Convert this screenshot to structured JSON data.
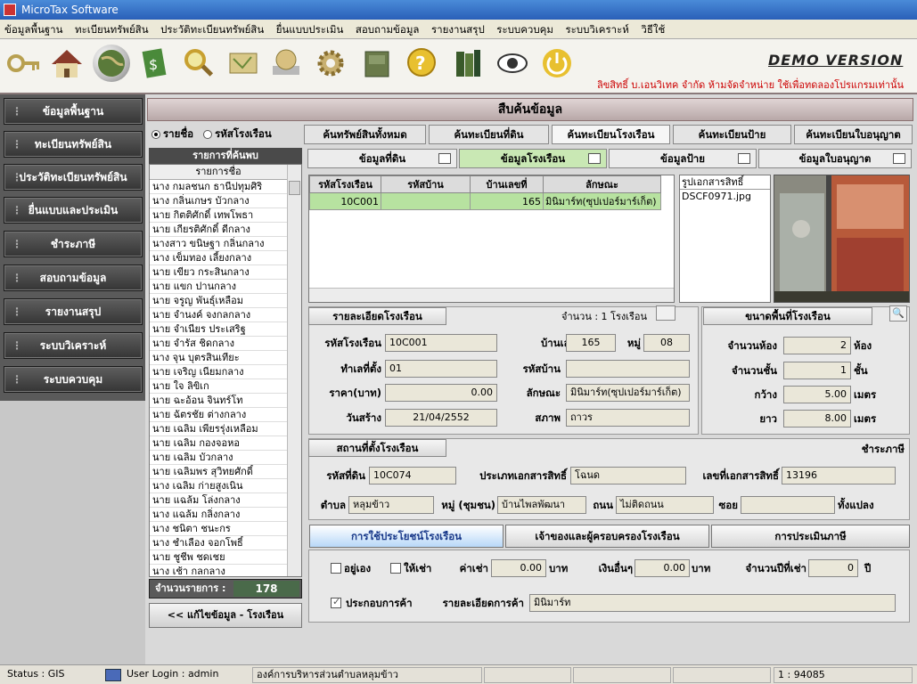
{
  "window": {
    "title": "MicroTax Software"
  },
  "menu": [
    "ข้อมูลพื้นฐาน",
    "ทะเบียนทรัพย์สิน",
    "ประวัติทะเบียนทรัพย์สิน",
    "ยื่นแบบประเมิน",
    "สอบถามข้อมูล",
    "รายงานสรุป",
    "ระบบควบคุม",
    "ระบบวิเคราะห์",
    "วิธีใช้"
  ],
  "toolbar": {
    "icons": [
      "key-icon",
      "house-icon",
      "globe-icon",
      "money-icon",
      "search-icon",
      "map-icon",
      "globe-book-icon",
      "gear-icon",
      "drive-icon",
      "help-icon",
      "books-icon",
      "eye-icon",
      "power-icon"
    ]
  },
  "demo": "DEMO VERSION",
  "copyright": "ลิขสิทธิ์ บ.เอนวิเทค จำกัด ห้ามจัดจำหน่าย ใช้เพื่อทดลองโปรแกรมเท่านั้น",
  "nav": [
    "ข้อมูลพื้นฐาน",
    "ทะเบียนทรัพย์สิน",
    "ประวัติทะเบียนทรัพย์สิน",
    "ยื่นแบบและประเมิน",
    "ชำระภาษี",
    "สอบถามข้อมูล",
    "รายงานสรุป",
    "ระบบวิเคราะห์",
    "ระบบควบคุม"
  ],
  "header": "สืบค้นข้อมูล",
  "search_mode": {
    "by_name": "รายชื่อ",
    "by_code": "รหัสโรงเรือน"
  },
  "tabs": [
    "ค้นทรัพย์สินทั้งหมด",
    "ค้นทะเบียนที่ดิน",
    "ค้นทะเบียนโรงเรือน",
    "ค้นทะเบียนป้าย",
    "ค้นทะเบียนใบอนุญาต"
  ],
  "subtabs": [
    "ข้อมูลที่ดิน",
    "ข้อมูลโรงเรือน",
    "ข้อมูลป้าย",
    "ข้อมูลใบอนุญาต"
  ],
  "list": {
    "title": "รายการที่ค้นพบ",
    "column": "รายการชื่อ",
    "rows": [
      "นาง กมลชนก ธานีปทุมศิริ",
      "นาง กลิ่นเกษร บัวกลาง",
      "นาย กิตติศักดิ์ เทพโพธา",
      "นาย เกียรติศักดิ์ ดีกลาง",
      "นางสาว ขนิษฐา กลิ่นกลาง",
      "นาง เข็มทอง เลี้ยงกลาง",
      "นาย เขียว กระสินกลาง",
      "นาย แขก ปานกลาง",
      "นาย จรูญ พันธุ์เหลือม",
      "นาย จำนงค์ จงกลกลาง",
      "นาย จำเนียร ประเสริฐ",
      "นาย จำรัส ชิดกลาง",
      "นาง จุน บุตรสินเทียะ",
      "นาย เจริญ เนียมกลาง",
      "นาย ใจ ลิขิเก",
      "นาย ฉะอ้อน จินทร์โท",
      "นาย ฉัตรชัย ต่างกลาง",
      "นาย เฉลิม เพียรรุ่งเหลือม",
      "นาย เฉลิม กองจอหอ",
      "นาย เฉลิม บัวกลาง",
      "นาย เฉลิมพร สุวิทยศักดิ์",
      "นาง เฉลิม ก่ายสูงเนิน",
      "นาย แฉล้ม โล่งกลาง",
      "นาง แฉล้ม กลิ่งกลาง",
      "นาง ชนิตา ชนะกร",
      "นาง ชำเลือง จอกโพธิ์",
      "นาย ชูชีพ ชดเชย",
      "นาง เช้า กลกลาง"
    ],
    "count_label": "จำนวนรายการ :",
    "count": "178",
    "edit_button": "<< แก้ไขข้อมูล - โรงเรือน"
  },
  "grid": {
    "headers": [
      "รหัสโรงเรือน",
      "รหัสบ้าน",
      "บ้านเลขที่",
      "ลักษณะ"
    ],
    "rows": [
      [
        "10C001",
        "",
        "165",
        "มินิมาร์ท(ซุปเปอร์มาร์เก็ต)"
      ]
    ]
  },
  "docs": {
    "header": "รูปเอกสารสิทธิ์",
    "file": "DSCF0971.jpg"
  },
  "building_detail": {
    "title": "รายละเอียดโรงเรือน",
    "count_text": "จำนวน : 1 โรงเรือน",
    "code_label": "รหัสโรงเรือน",
    "code": "10C001",
    "houseno_label": "บ้านเลขที่",
    "houseno": "165",
    "moo_label": "หมู่",
    "moo": "08",
    "location_label": "ทำเลที่ตั้ง",
    "location": "01",
    "housecode_label": "รหัสบ้าน",
    "housecode": "",
    "price_label": "ราคา(บาท)",
    "price": "0.00",
    "type_label": "ลักษณะ",
    "type": "มินิมาร์ท(ซุปเปอร์มาร์เก็ต)",
    "created_label": "วันสร้าง",
    "created": "21/04/2552",
    "condition_label": "สภาพ",
    "condition": "ถาวร"
  },
  "area": {
    "title": "ขนาดพื้นที่โรงเรือน",
    "rooms_label": "จำนวนห้อง",
    "rooms": "2",
    "rooms_unit": "ห้อง",
    "floors_label": "จำนวนชั้น",
    "floors": "1",
    "floors_unit": "ชั้น",
    "width_label": "กว้าง",
    "width": "5.00",
    "width_unit": "เมตร",
    "length_label": "ยาว",
    "length": "8.00",
    "length_unit": "เมตร"
  },
  "location": {
    "title": "สถานที่ตั้งโรงเรือน",
    "tax_link": "ชำระภาษี",
    "land_label": "รหัสที่ดิน",
    "land": "10C074",
    "doctype_label": "ประเภทเอกสารสิทธิ์",
    "doctype": "โฉนด",
    "docno_label": "เลขที่เอกสารสิทธิ์",
    "docno": "13196",
    "tambon_label": "ตำบล",
    "tambon": "หลุมข้าว",
    "village_label": "หมู่ (ชุมชน)",
    "village": "บ้านไพลพัฒนา",
    "road_label": "ถนน",
    "road": "ไม่ติดถนน",
    "soi_label": "ซอย",
    "soi": "",
    "plot_label": "ทั้งแปลง"
  },
  "bottom_tabs": [
    "การใช้ประโยชน์โรงเรือน",
    "เจ้าของและผู้ครอบครองโรงเรือน",
    "การประเมินภาษี"
  ],
  "usage": {
    "self_label": "อยู่เอง",
    "rent_label": "ให้เช่า",
    "rent_fee_label": "ค่าเช่า",
    "rent_fee": "0.00",
    "baht": "บาท",
    "other_label": "เงินอื่นๆ",
    "other": "0.00",
    "years_label": "จำนวนปีที่เช่า",
    "years": "0",
    "year_unit": "ปี",
    "business_label": "ประกอบการค้า",
    "business_detail_label": "รายละเอียดการค้า",
    "business_detail": "มินิมาร์ท"
  },
  "status": {
    "gis": "Status : GIS",
    "login": "User Login : admin",
    "org": "องค์การบริหารส่วนตำบลหลุมข้าว",
    "scale": "1 : 94085"
  }
}
